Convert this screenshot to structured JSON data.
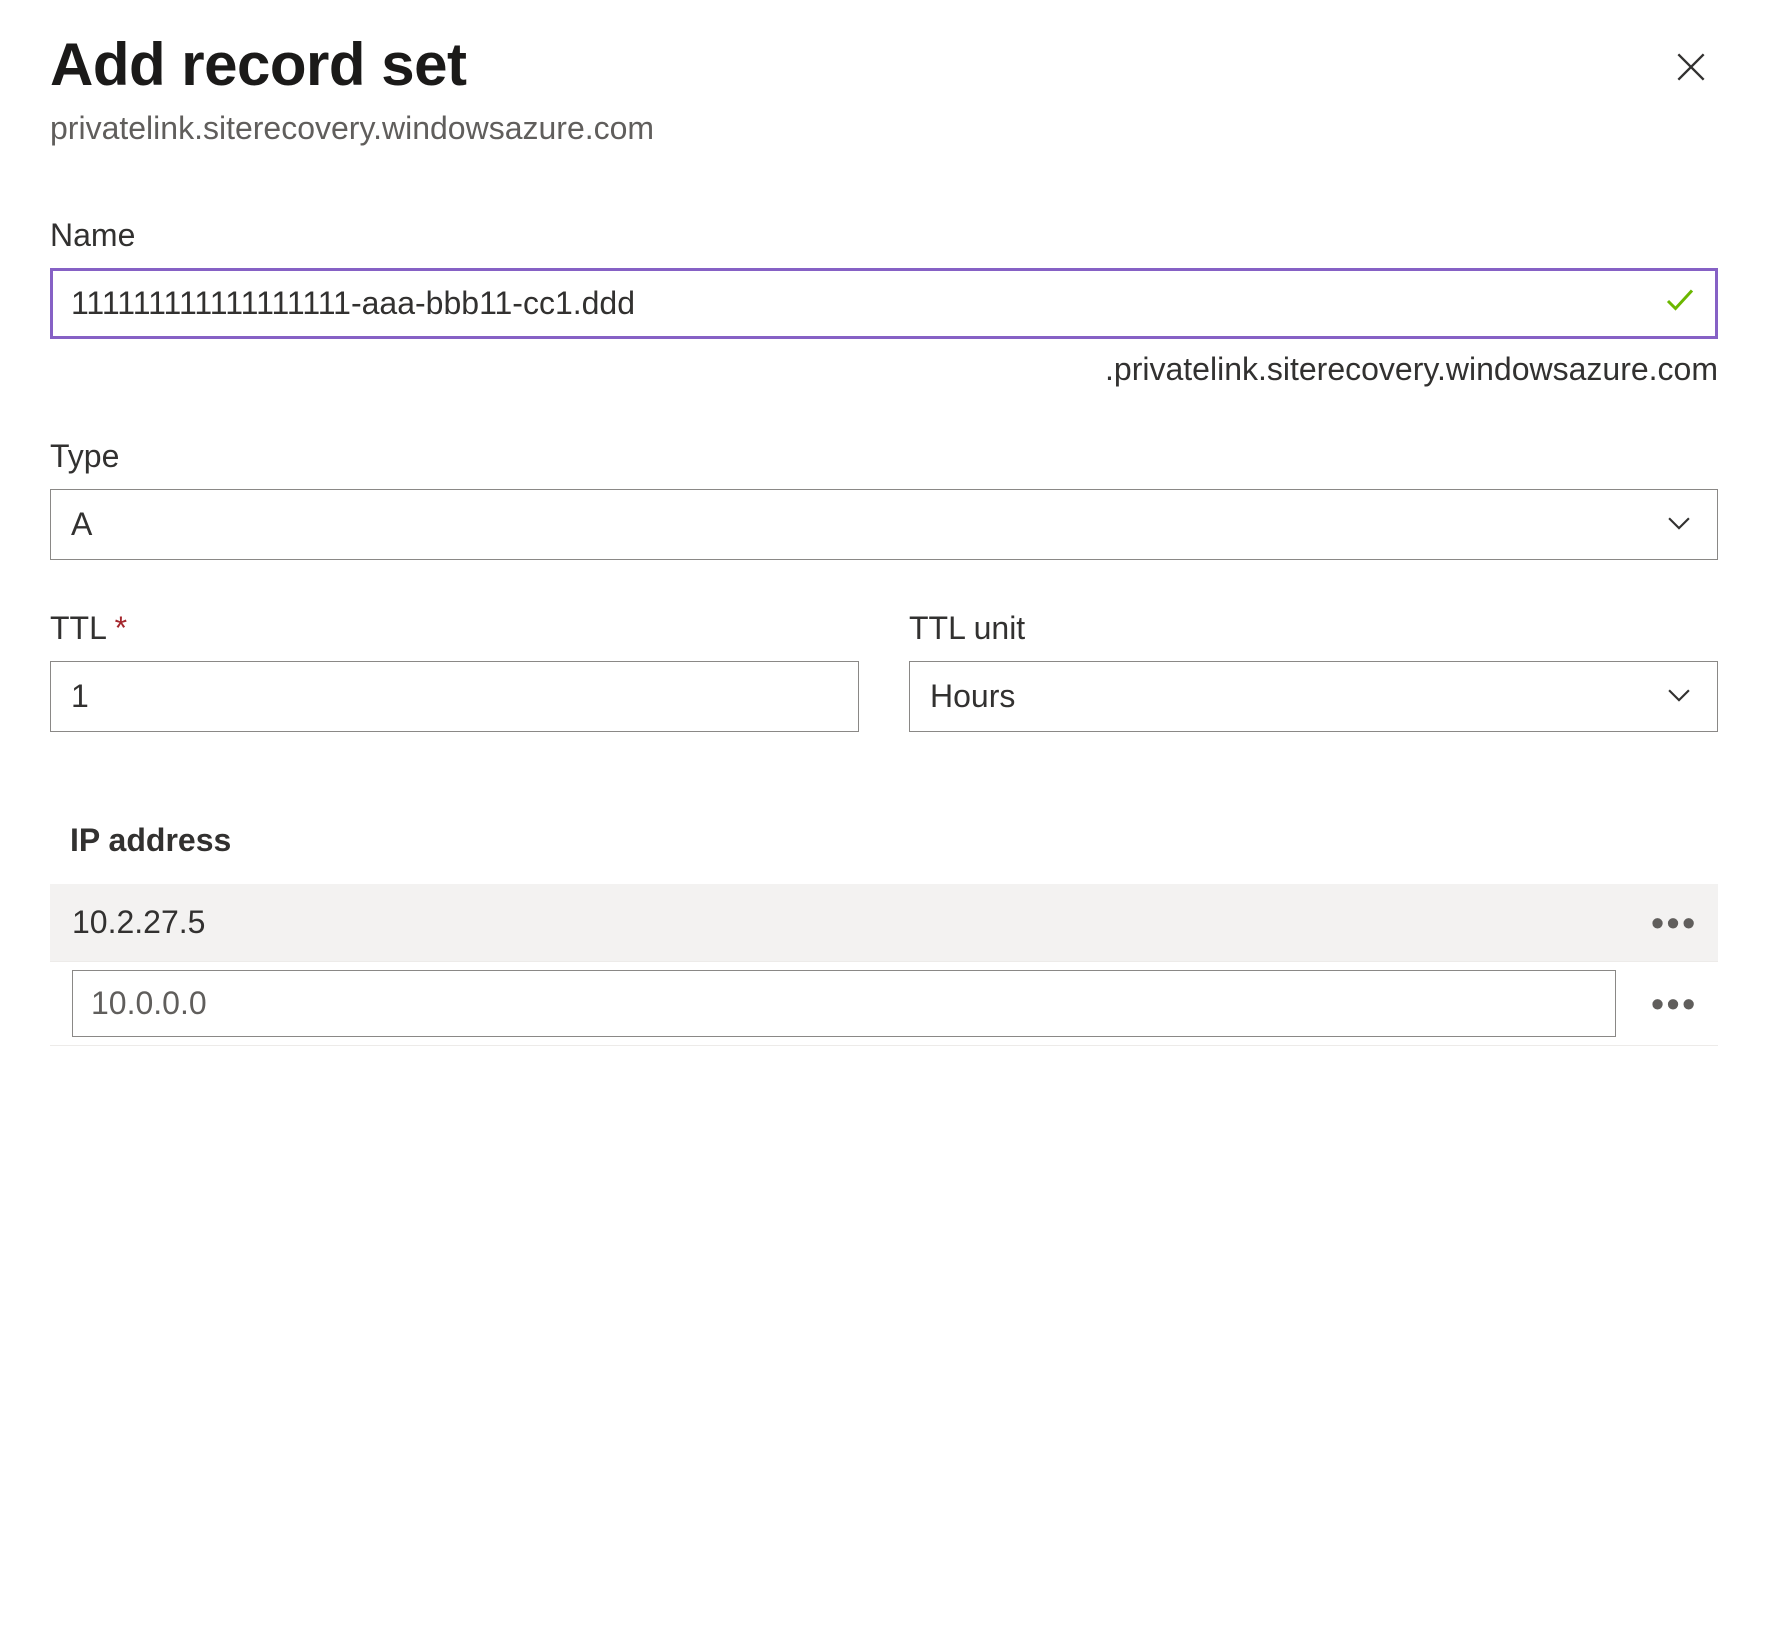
{
  "header": {
    "title": "Add record set",
    "subtitle": "privatelink.siterecovery.windowsazure.com"
  },
  "fields": {
    "name": {
      "label": "Name",
      "value": "111111111111111111-aaa-bbb11-cc1.ddd",
      "suffix": ".privatelink.siterecovery.windowsazure.com"
    },
    "type": {
      "label": "Type",
      "value": "A"
    },
    "ttl": {
      "label": "TTL",
      "value": "1"
    },
    "ttl_unit": {
      "label": "TTL unit",
      "value": "Hours"
    }
  },
  "ip_section": {
    "header": "IP address",
    "rows": [
      {
        "value": "10.2.27.5"
      }
    ],
    "placeholder": "10.0.0.0"
  }
}
